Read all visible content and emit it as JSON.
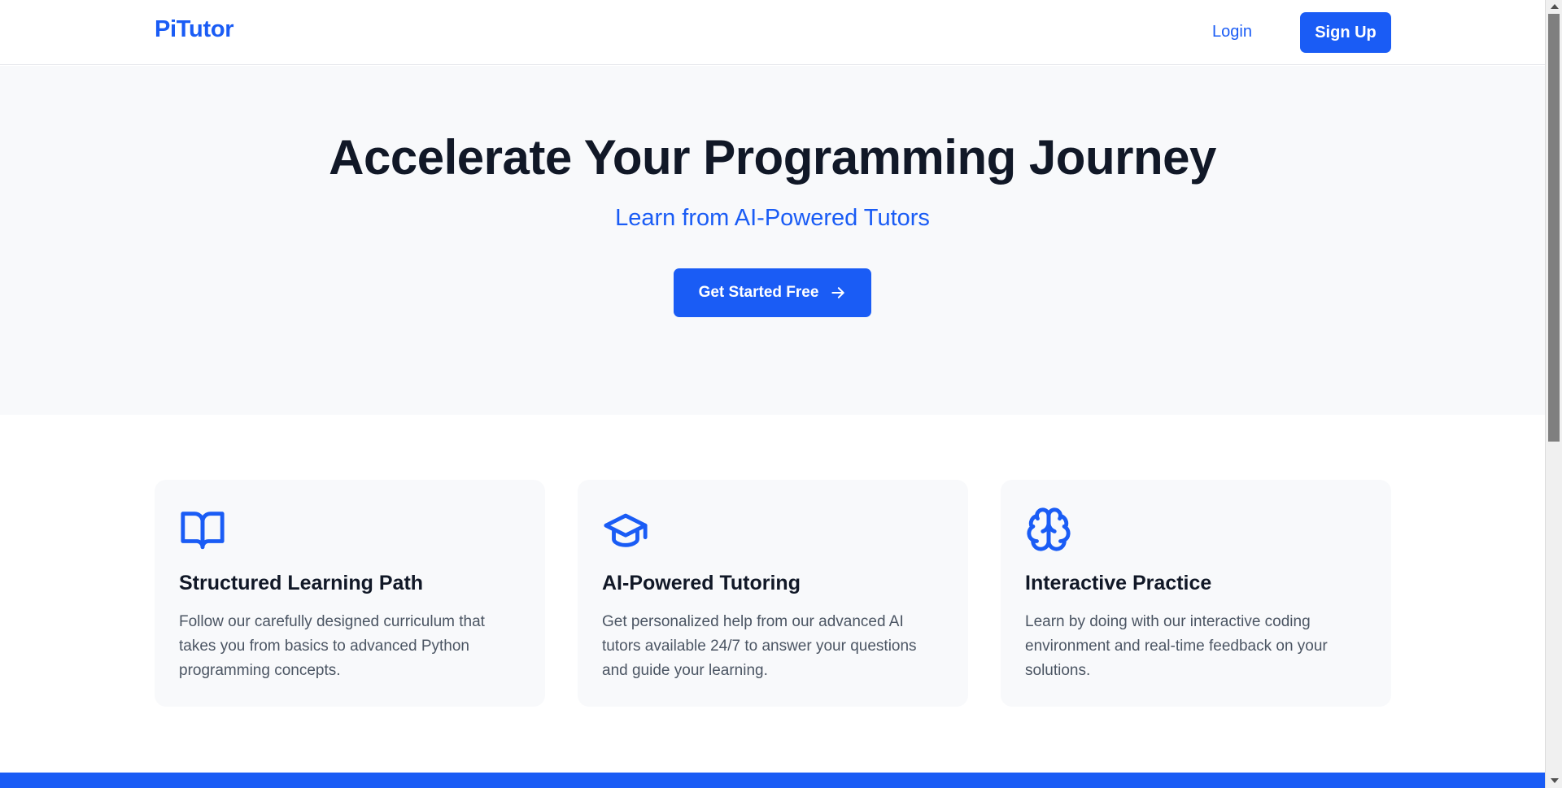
{
  "header": {
    "logo": "PiTutor",
    "login_label": "Login",
    "signup_label": "Sign Up"
  },
  "hero": {
    "title": "Accelerate Your Programming Journey",
    "subtitle": "Learn from AI-Powered Tutors",
    "cta_label": "Get Started Free",
    "cta_icon": "arrow-right-icon"
  },
  "features": [
    {
      "icon": "book-open-icon",
      "title": "Structured Learning Path",
      "description": "Follow our carefully designed curriculum that takes you from basics to advanced Python programming concepts."
    },
    {
      "icon": "graduation-cap-icon",
      "title": "AI-Powered Tutoring",
      "description": "Get personalized help from our advanced AI tutors available 24/7 to answer your questions and guide your learning."
    },
    {
      "icon": "brain-icon",
      "title": "Interactive Practice",
      "description": "Learn by doing with our interactive coding environment and real-time feedback on your solutions."
    }
  ],
  "colors": {
    "brand": "#1a5cf5",
    "heading": "#111827",
    "body_text": "#4b5563",
    "hero_bg": "#f8f9fb",
    "card_bg": "#f8f9fb"
  }
}
